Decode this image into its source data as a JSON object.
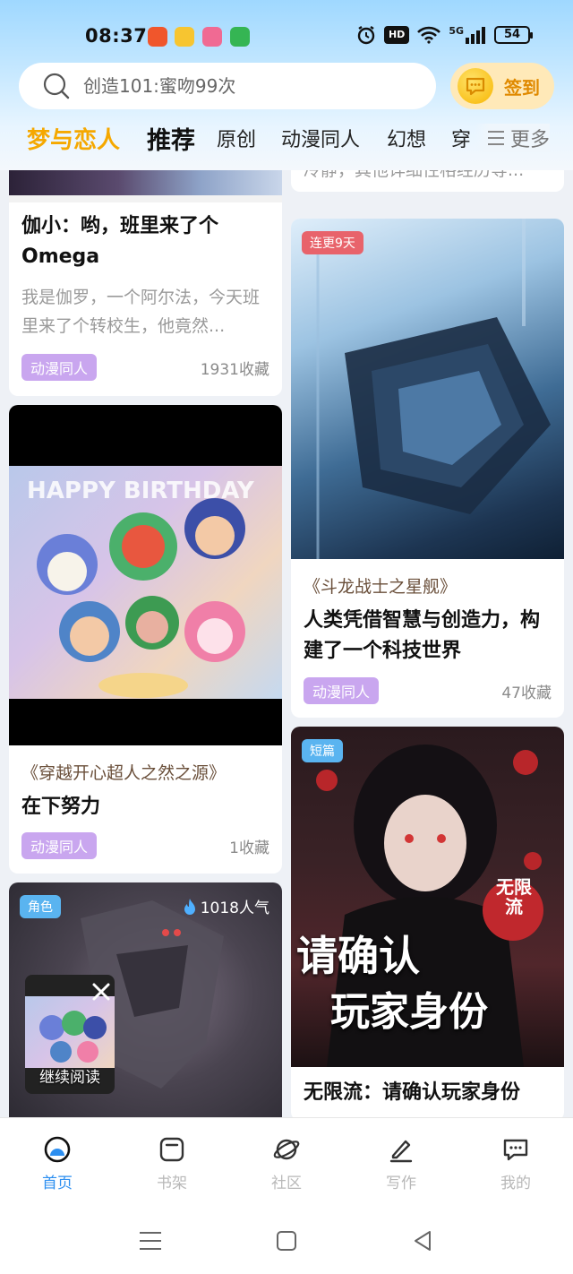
{
  "status_bar": {
    "time": "08:37",
    "network": "5G",
    "battery": "54"
  },
  "search": {
    "placeholder": "创造101:蜜吻99次"
  },
  "checkin": {
    "label": "签到"
  },
  "tabs": {
    "brand": "梦与恋人",
    "items": [
      "推荐",
      "原创",
      "动漫同人",
      "幻想",
      "穿"
    ],
    "more": "更多"
  },
  "cards": {
    "top_right_desc": "冷静，其他详细性格经历等...",
    "c1": {
      "title": "伽小：哟，班里来了个Omega",
      "desc": "我是伽罗，一个阿尔法，今天班里来了个转校生，他竟然...",
      "tag": "动漫同人",
      "fav": "1931收藏"
    },
    "c2": {
      "quote": "《穿越开心超人之然之源》",
      "title": "在下努力",
      "tag": "动漫同人",
      "fav": "1收藏"
    },
    "c3": {
      "badge": "角色",
      "popularity": "1018人气"
    },
    "c4": {
      "badge": "连更9天",
      "quote": "《斗龙战士之星舰》",
      "title": "人类凭借智慧与创造力，构建了一个科技世界",
      "tag": "动漫同人",
      "fav": "47收藏"
    },
    "c5": {
      "badge": "短篇",
      "cover_line1": "请确认",
      "cover_line2": "玩家身份",
      "cover_seal": "无限流",
      "title": "无限流：请确认玩家身份"
    }
  },
  "float": {
    "label": "继续阅读"
  },
  "bottom_nav": [
    "首页",
    "书架",
    "社区",
    "写作",
    "我的"
  ],
  "colors": {
    "accent": "#2d8ff0",
    "brand": "#f5a800",
    "tag": "#c9a6ef",
    "badge_red": "#e8636b",
    "badge_blue": "#5ab4f0"
  }
}
